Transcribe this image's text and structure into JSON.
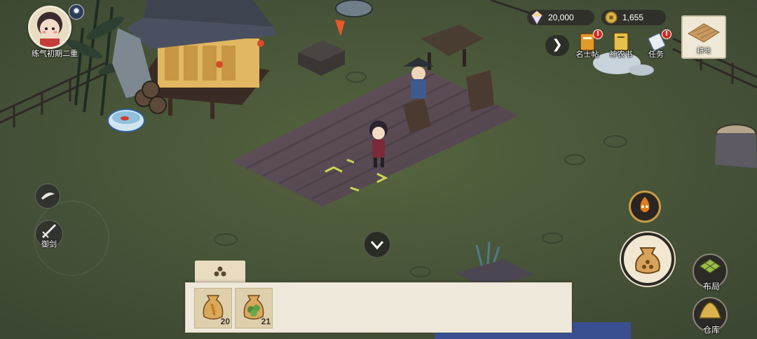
{
  "player": {
    "realm_label": "练气初期二重",
    "avatar_icon": "girl-portrait-icon",
    "time_icon": "sun-icon"
  },
  "currency": {
    "jade": {
      "value": "20,000",
      "icon": "spirit-crystal-icon"
    },
    "coin": {
      "value": "1,655",
      "icon": "copper-coin-icon"
    }
  },
  "top_buttons": {
    "collapse_icon": "chevron-right-icon",
    "mingshitie": {
      "label": "名士帖",
      "icon": "invitation-card-icon",
      "badge": "!"
    },
    "shennongshu": {
      "label": "神农书",
      "icon": "book-icon",
      "badge": ""
    },
    "renwu": {
      "label": "任务",
      "icon": "scroll-quest-icon",
      "badge": "!"
    }
  },
  "farmland": {
    "label": "耕地",
    "icon": "tilled-field-icon"
  },
  "left_controls": {
    "feather_icon": "feather-icon",
    "sword": {
      "label": "御剑",
      "icon": "sword-icon"
    }
  },
  "right_controls": {
    "skill_icon": "flame-beast-icon",
    "main_action_icon": "seed-bag-icon",
    "layout": {
      "label": "布局",
      "icon": "layout-grid-icon"
    },
    "warehouse": {
      "label": "仓库",
      "icon": "hay-pile-icon"
    }
  },
  "seed_panel": {
    "tab_icon": "seeds-icon",
    "slots": [
      {
        "icon": "wheat-seed-bag-icon",
        "count": "20"
      },
      {
        "icon": "leaf-seed-bag-icon",
        "count": "21"
      }
    ]
  },
  "colors": {
    "grass": "#4b5a3c",
    "soil": "#5c4c53",
    "panel": "#efe9dc",
    "badge": "#d62b22"
  }
}
